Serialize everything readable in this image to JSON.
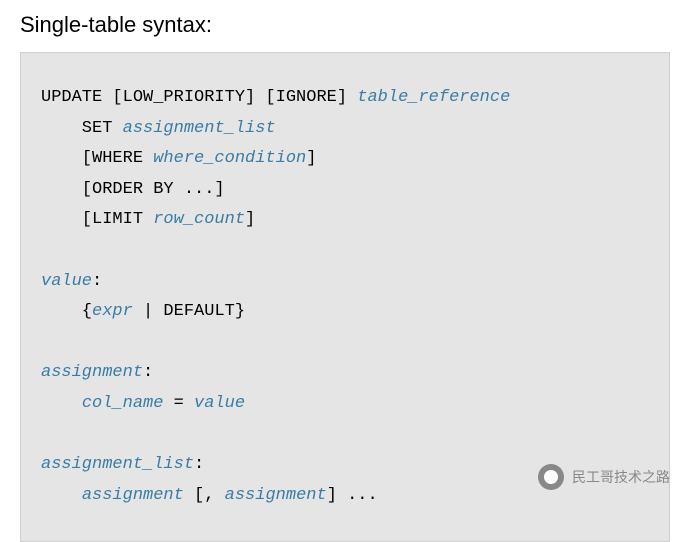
{
  "heading": "Single-table syntax:",
  "code": {
    "line1": {
      "t1": "UPDATE [LOW_PRIORITY] [IGNORE] ",
      "p1": "table_reference"
    },
    "line2": {
      "t1": "    SET ",
      "p1": "assignment_list"
    },
    "line3": {
      "t1": "    [WHERE ",
      "p1": "where_condition",
      "t2": "]"
    },
    "line4": {
      "t1": "    [ORDER BY ...]"
    },
    "line5": {
      "t1": "    [LIMIT ",
      "p1": "row_count",
      "t2": "]"
    },
    "line6": {
      "p1": "value",
      "t1": ":"
    },
    "line7": {
      "t1": "    {",
      "p1": "expr",
      "t2": " | DEFAULT}"
    },
    "line8": {
      "p1": "assignment",
      "t1": ":"
    },
    "line9": {
      "t1": "    ",
      "p1": "col_name",
      "t2": " = ",
      "p2": "value"
    },
    "line10": {
      "p1": "assignment_list",
      "t1": ":"
    },
    "line11": {
      "t1": "    ",
      "p1": "assignment",
      "t2": " [, ",
      "p2": "assignment",
      "t3": "] ..."
    }
  },
  "watermark": {
    "text": "民工哥技术之路",
    "icon": "wechat-icon"
  }
}
